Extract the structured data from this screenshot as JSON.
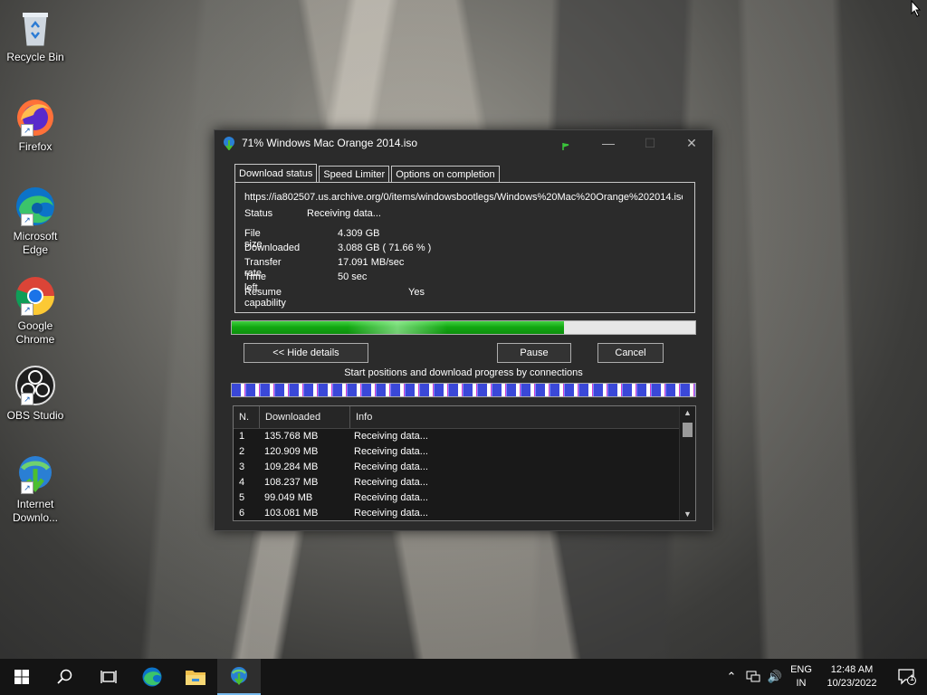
{
  "desktop": {
    "icons": [
      {
        "label": "Recycle Bin",
        "icon": "recycle-bin-icon"
      },
      {
        "label": "Firefox",
        "icon": "firefox-icon"
      },
      {
        "label": "Microsoft Edge",
        "icon": "edge-icon"
      },
      {
        "label": "Google Chrome",
        "icon": "chrome-icon"
      },
      {
        "label": "OBS Studio",
        "icon": "obs-icon"
      },
      {
        "label": "Internet Downlo...",
        "icon": "idm-icon"
      }
    ]
  },
  "window": {
    "title": "71% Windows Mac Orange 2014.iso",
    "tabs": [
      "Download status",
      "Speed Limiter",
      "Options on completion"
    ],
    "url": "https://ia802507.us.archive.org/0/items/windowsbootlegs/Windows%20Mac%20Orange%202014.iso",
    "status_label": "Status",
    "status_value": "Receiving data...",
    "file_size_label": "File size",
    "file_size_value": "4.309  GB",
    "downloaded_label": "Downloaded",
    "downloaded_value": "3.088  GB  ( 71.66 % )",
    "transfer_rate_label": "Transfer rate",
    "transfer_rate_value": "17.091  MB/sec",
    "time_left_label": "Time left",
    "time_left_value": "50 sec",
    "resume_label": "Resume capability",
    "resume_value": "Yes",
    "progress_fraction": 0.7166,
    "hide_details_label": "<< Hide details",
    "pause_label": "Pause",
    "cancel_label": "Cancel",
    "connections_label": "Start positions and download progress by connections",
    "list_headers": [
      "N.",
      "Downloaded",
      "Info"
    ],
    "connections": [
      {
        "n": "1",
        "downloaded": "135.768  MB",
        "info": "Receiving data..."
      },
      {
        "n": "2",
        "downloaded": "120.909  MB",
        "info": "Receiving data..."
      },
      {
        "n": "3",
        "downloaded": "109.284  MB",
        "info": "Receiving data..."
      },
      {
        "n": "4",
        "downloaded": "108.237  MB",
        "info": "Receiving data..."
      },
      {
        "n": "5",
        "downloaded": "99.049  MB",
        "info": "Receiving data..."
      },
      {
        "n": "6",
        "downloaded": "103.081  MB",
        "info": "Receiving data..."
      }
    ]
  },
  "taskbar": {
    "lang_top": "ENG",
    "lang_bottom": "IN",
    "time": "12:48 AM",
    "date": "10/23/2022",
    "notification_count": "1"
  },
  "colors": {
    "progress_fill": "#12a812",
    "taskbar_bg": "#141414",
    "window_bg": "#2b2b2b"
  }
}
